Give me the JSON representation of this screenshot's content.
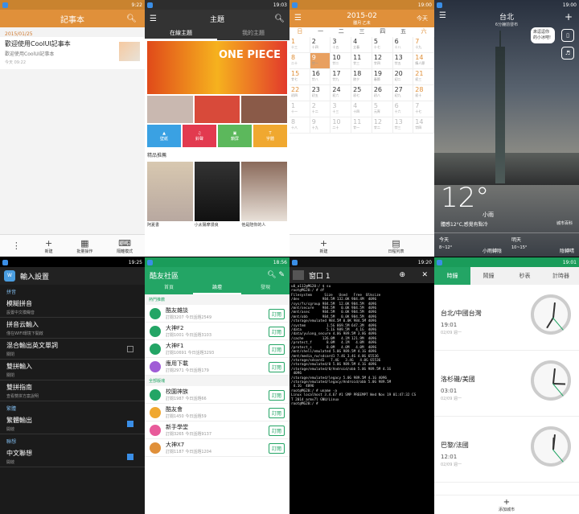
{
  "notepad": {
    "time": "9:22",
    "title": "記事本",
    "date": "2015/01/25",
    "note_title": "歡迎使用CoolUI記事本",
    "note_snippet": "歡迎使用CoolUI記事本",
    "note_time": "今天 09:22",
    "buttons": [
      "新建",
      "批量操作",
      "隔離模式"
    ]
  },
  "theme": {
    "time": "19:03",
    "title": "主題",
    "tabs": [
      "在線主題",
      "我的主題"
    ],
    "banner": "ONE PIECE",
    "tiles": [
      "壁紙",
      "鈴聲",
      "鎖屏",
      "字體"
    ],
    "tile_colors": [
      "#3aa1e3",
      "#e23a4f",
      "#5cb85c",
      "#f0a830"
    ],
    "section": "精品推薦",
    "recs": [
      "阿夏書",
      "小太陽摩漫良",
      "他是陪你的人"
    ]
  },
  "calendar": {
    "time": "19:00",
    "month": "2015-02",
    "lunar": "臘月 乙未",
    "today": "今天",
    "weekdays": [
      "日",
      "一",
      "二",
      "三",
      "四",
      "五",
      "六"
    ],
    "cells": [
      "1",
      "2",
      "3",
      "4",
      "5",
      "6",
      "7",
      "8",
      "9",
      "10",
      "11",
      "12",
      "13",
      "14",
      "15",
      "16",
      "17",
      "18",
      "19",
      "20",
      "21",
      "22",
      "23",
      "24",
      "25",
      "26",
      "27",
      "28",
      "1",
      "2",
      "3",
      "4",
      "5",
      "6",
      "7",
      "8",
      "9",
      "10",
      "11",
      "12",
      "13",
      "14"
    ],
    "lunar_cells": [
      "十三",
      "十四",
      "十五",
      "立春",
      "十七",
      "十八",
      "十九",
      "二十",
      "廿一",
      "廿二",
      "廿三",
      "廿四",
      "廿五",
      "情人節",
      "廿七",
      "廿八",
      "廿九",
      "除夕",
      "春節",
      "初二",
      "初三",
      "初四",
      "初五",
      "初六",
      "初七",
      "初八",
      "初九",
      "初十",
      "十一",
      "十二",
      "十三",
      "十四",
      "元宵",
      "十六",
      "十七",
      "十八",
      "十九",
      "二十",
      "廿一",
      "廿二",
      "廿三",
      "廿四"
    ],
    "buttons": [
      "新建",
      "日程列表"
    ]
  },
  "weather": {
    "time": "19:00",
    "city": "台北",
    "updated": "6分鐘前發布",
    "bubble": "來逗逗你的小冰吧!",
    "temp": "12°",
    "unit": "小雨",
    "feels": "體感12°C,感覺有點冷",
    "source": "城市百科",
    "today": "今天",
    "today_range": "8~12°",
    "today_wx": "小雨轉陰",
    "tmr": "明天",
    "tmr_range": "10~15°",
    "tmr_wx": "陰轉晴"
  },
  "ime": {
    "time": "19:25",
    "title": "輸入設置",
    "items": [
      {
        "cat": "拼音"
      },
      {
        "a": "模糊拼音",
        "b": "設置中文模糊音"
      },
      {
        "a": "拼音云輸入",
        "b": "僅在WIFI環境下開啟"
      },
      {
        "a": "混合輸出英文單詞",
        "b": "關閉",
        "ck": false
      },
      {
        "a": "雙拼輸入",
        "b": "關閉"
      },
      {
        "a": "雙拼指南",
        "b": "查看雙拼方案說明"
      },
      {
        "cat": "繁體"
      },
      {
        "a": "繁體輸出",
        "b": "開啟",
        "ck": true
      },
      {
        "cat": "聯想"
      },
      {
        "a": "中文聯想",
        "b": "開啟",
        "ck": true
      }
    ]
  },
  "community": {
    "time": "18:56",
    "title": "酷友社區",
    "tabs": [
      "首頁",
      "論壇",
      "發現"
    ],
    "sec1": "熱門推薦",
    "sec2": "全部版塊",
    "follow": "訂閱",
    "forums": [
      {
        "n": "酷友雜談",
        "s": "訂閱3207 今日話題2549",
        "c": "#23a565"
      },
      {
        "n": "大神F2",
        "s": "訂閱1001 今日話題3103",
        "c": "#23a565"
      },
      {
        "n": "大神F1",
        "s": "訂閱10691 今日話題3293",
        "c": "#23a565"
      },
      {
        "n": "應用下載",
        "s": "訂閱2971 今日話題179",
        "c": "#a05cd6"
      },
      {
        "n": "校園神族",
        "s": "訂閱1987 今日話題66",
        "c": "#23a565"
      },
      {
        "n": "酷友會",
        "s": "訂閱1450 今日話題59",
        "c": "#f0a830"
      },
      {
        "n": "新手學堂",
        "s": "訂閱3265 今日話題9137",
        "c": "#e85a9a"
      },
      {
        "n": "大神X7",
        "s": "訂閱1187 今日話題1204",
        "c": "#e0903a"
      }
    ]
  },
  "terminal": {
    "time": "19:20",
    "title": "窗口 1",
    "text": "u0_a112@MG20:/ $ su\nroot@MG20:/ # df\nFilesystem      Size   Used   Free  Blksize\n/dev           984.5M 132.0K 984.4M  4096\n/sys/fs/cgroup 984.5M  12.0K 984.5M  4096\n/mnt/secure    984.5M   0.0K 984.5M  4096\n/mnt/asec      984.5M   0.0K 984.5M  4096\n/mnt/obb       984.5M   0.0K 984.5M  4096\n/storage/emulated 984.5M 0.0K 984.5M 4096\n/system          1.5G 869.5M 647.3M  4096\n/data            5.1G 989.5M   4.1G  4096\n/data/yulong_secure 4.0G 989.5M 3.8G 4096\n/cache         126.0M   4.1M 121.9M  4096\n/protect_f       8.0M   4.1M   4.0M  4096\n/protect_s       8.0M   4.0M   4.0M  4096\n/mnt/shell/emulated 5.0G 989.5M 4.1G 4096\n/mnt/media_rw/sdcard1 7.4G 3.4G 4.0G 65536\n/storage/sdcard1   7.4G   3.4G   4.0G 65536\n/storage/emulated/0 5.0G 989.5M 4.1G 4096\n/storage/emulated/0/Android/obb 5.0G 989.5M 4.1G\n 4096\n/storage/emulated/legacy 5.0G 989.5M 4.1G 4096\n/storage/emulated/legacy/Android/obb 5.0G 989.5M\n 4.1G  4096\nroot@MG20:/ # uname -a\nLinux localhost 3.4.67 #1 SMP PREEMPT Wed Nov 19 01:47:32 CS\nT 2014 armv7l GNU/Linux\nroot@MG20:/ # "
  },
  "clock": {
    "time": "19:01",
    "tabs": [
      "時鐘",
      "鬧鐘",
      "秒表",
      "計時器"
    ],
    "add": "添加城市",
    "cities": [
      {
        "n": "台北/中國台灣",
        "t": "19:01",
        "w": "02/09 週一",
        "hdeg": 212,
        "mdeg": 6
      },
      {
        "n": "洛杉磯/美國",
        "t": "03:01",
        "w": "02/09 週一",
        "hdeg": 92,
        "mdeg": 6
      },
      {
        "n": "巴黎/法國",
        "t": "12:01",
        "w": "02/09 週一",
        "hdeg": 2,
        "mdeg": 6
      }
    ]
  }
}
